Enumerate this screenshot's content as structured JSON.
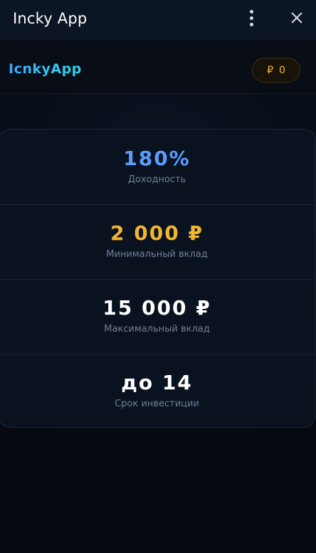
{
  "window": {
    "title": "Incky App"
  },
  "header": {
    "logo_text": "IcnkyApp",
    "balance_currency": "₽",
    "balance_amount": "0"
  },
  "stats": [
    {
      "value": "180%",
      "label": "Доходность",
      "color": "#5b9dff"
    },
    {
      "value": "2 000 ₽",
      "label": "Минимальный вклад",
      "color": "#f2b52e"
    },
    {
      "value": "15 000 ₽",
      "label": "Максимальный вклад",
      "color": "#ffffff"
    },
    {
      "value": "до 14",
      "label": "Срок инвестиции",
      "color": "#ffffff"
    }
  ],
  "icons": {
    "menu": "kebab-menu-icon",
    "close": "close-icon"
  }
}
